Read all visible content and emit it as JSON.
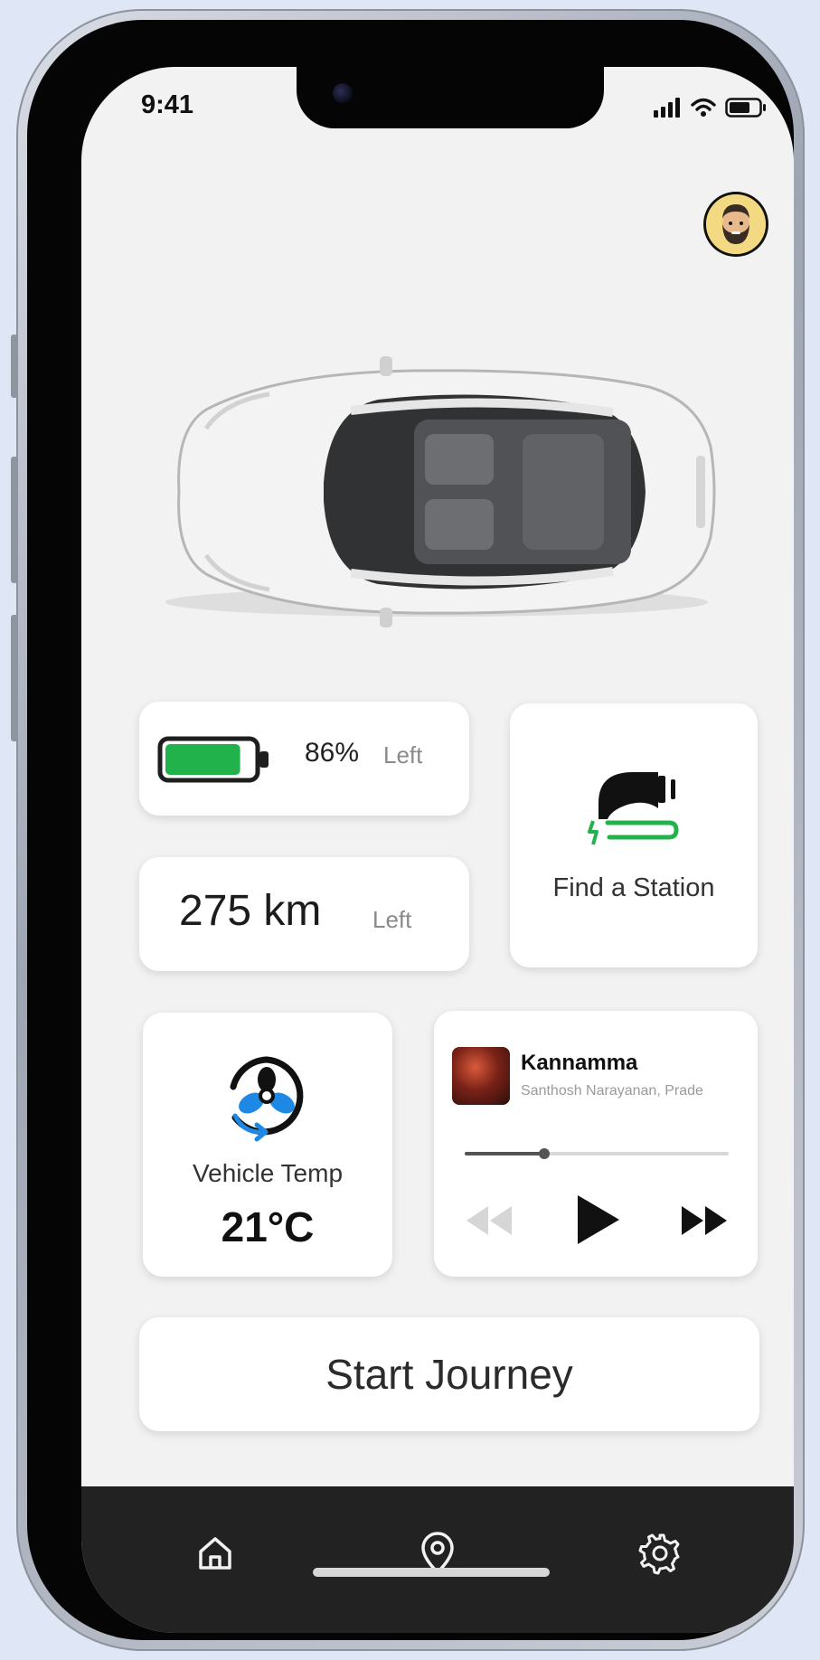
{
  "status_bar": {
    "time": "9:41"
  },
  "profile": {
    "avatar_icon": "bearded-man-avatar-icon"
  },
  "vehicle": {
    "image": "white-ev-top-view"
  },
  "battery": {
    "percent_label": "86%",
    "left_label": "Left",
    "level": 0.86,
    "fill_color": "#22b24c"
  },
  "range": {
    "value": "275 km",
    "left_label": "Left"
  },
  "station": {
    "label": "Find a Station",
    "icon": "ev-charger-plug-icon",
    "accent": "#22b24c"
  },
  "climate": {
    "label": "Vehicle Temp",
    "value": "21°C",
    "icon": "fan-icon",
    "accent": "#1e88e5"
  },
  "music": {
    "title": "Kannamma",
    "artist": "Santhosh Narayanan, Prade",
    "progress": 0.3,
    "controls": [
      "rewind-icon",
      "play-icon",
      "fast-forward-icon"
    ]
  },
  "journey": {
    "label": "Start Journey"
  },
  "nav": {
    "items": [
      "home-icon",
      "location-pin-icon",
      "settings-gear-icon"
    ]
  }
}
